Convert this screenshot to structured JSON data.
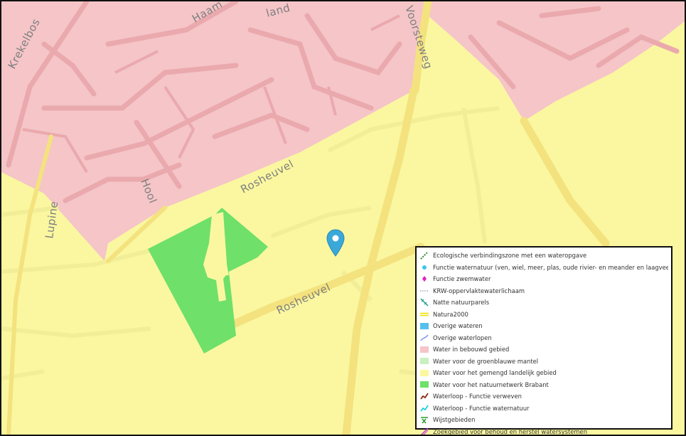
{
  "map": {
    "colors": {
      "built": "#f5c5c8",
      "rural": "#faf7a0",
      "nature": "#6fe06a",
      "road_major": "#f3e27e",
      "road_minor_rural": "#f2ee98",
      "road_minor_built": "#eaa9ad"
    },
    "streets": [
      {
        "name": "Krekelbos"
      },
      {
        "name": "Haam"
      },
      {
        "name": "land"
      },
      {
        "name": "Voorsteweg"
      },
      {
        "name": "Hool"
      },
      {
        "name": "Rosheuvel"
      },
      {
        "name": "Lupine"
      },
      {
        "name": "Rosheuvel"
      }
    ],
    "marker": {
      "icon": "map-pin-icon",
      "color": "#3aa8d8"
    }
  },
  "legend": {
    "items": [
      {
        "label": "Ecologische verbindingszone met een wateropgave",
        "icon": "dashed-green-line-icon",
        "color": "#2e8b2e"
      },
      {
        "label": "Functie waternatuur (ven, wiel, meer, plas, oude rivier- en meander en laagveengebied)",
        "icon": "cyan-dot-icon",
        "color": "#3cc8e8"
      },
      {
        "label": "Functie zwemwater",
        "icon": "magenta-diamond-icon",
        "color": "#e020c0"
      },
      {
        "label": "KRW-oppervlaktewaterlichaam",
        "icon": "dotted-line-icon",
        "color": "#8888aa"
      },
      {
        "label": "Natte natuurparels",
        "icon": "teal-hatch-line-icon",
        "color": "#1a9a8a"
      },
      {
        "label": "Natura2000",
        "icon": "yellow-double-line-icon",
        "color": "#f0e000"
      },
      {
        "label": "Overige wateren",
        "icon": "blue-fill-icon",
        "color": "#55c0ee"
      },
      {
        "label": "Overige waterlopen",
        "icon": "blue-line-icon",
        "color": "#7a8ff0"
      },
      {
        "label": "Water in bebouwd gebied",
        "icon": "pink-fill-icon",
        "color": "#f5c5c8"
      },
      {
        "label": "Water voor de groenblauwe mantel",
        "icon": "light-green-fill-icon",
        "color": "#c8f0c0"
      },
      {
        "label": "Water voor het gemengd landelijk gebied",
        "icon": "yellow-fill-icon",
        "color": "#faf7a0"
      },
      {
        "label": "Water voor het natuurnetwerk Brabant",
        "icon": "green-fill-icon",
        "color": "#6fe06a"
      },
      {
        "label": "Waterloop - Functie verweven",
        "icon": "brown-line-icon",
        "color": "#8b2a10"
      },
      {
        "label": "Waterloop - Functie waternatuur",
        "icon": "cyan-line-icon",
        "color": "#20d0e0"
      },
      {
        "label": "Wijstgebieden",
        "icon": "green-cross-line-icon",
        "color": "#2a9a2a"
      },
      {
        "label": "Zoekgebied voor behoud en herstel watersystemen",
        "icon": "magenta-line-icon",
        "color": "#c030d0"
      }
    ]
  }
}
